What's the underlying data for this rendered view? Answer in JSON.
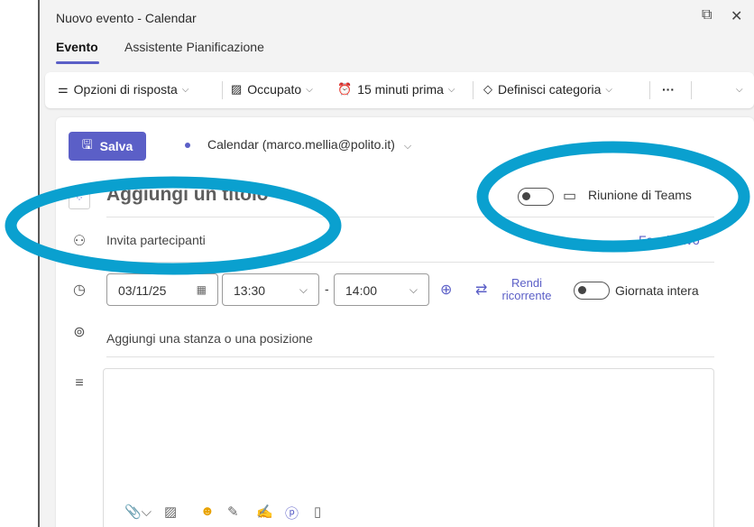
{
  "window": {
    "title": "Nuovo evento - Calendar",
    "popout_icon": "popout-icon",
    "close_icon": "close-icon"
  },
  "tabs": [
    {
      "label": "Evento",
      "active": true
    },
    {
      "label": "Assistente Pianificazione",
      "active": false
    }
  ],
  "ribbon": {
    "response_options": "Opzioni di risposta",
    "busy": "Occupato",
    "reminder": "15 minuti prima",
    "category": "Definisci categoria",
    "more": "···"
  },
  "header": {
    "save_label": "Salva",
    "calendar": "Calendar (marco.mellia@polito.it)"
  },
  "event": {
    "title_placeholder": "Aggiungi un titolo",
    "teams_toggle_on": false,
    "teams_label": "Riunione di Teams",
    "invite_placeholder": "Invita partecipanti",
    "optional_label": "Facoltativo",
    "date": "03/11/25",
    "start_time": "13:30",
    "dash": "-",
    "end_time": "14:00",
    "recurrence_label": "Rendi ricorrente",
    "allday_toggle_on": false,
    "allday_label": "Giornata intera",
    "location_placeholder": "Aggiungi una stanza o una posizione"
  },
  "colors": {
    "accent": "#5b5fc7",
    "annotation_ellipse": "#0aa0cf"
  }
}
